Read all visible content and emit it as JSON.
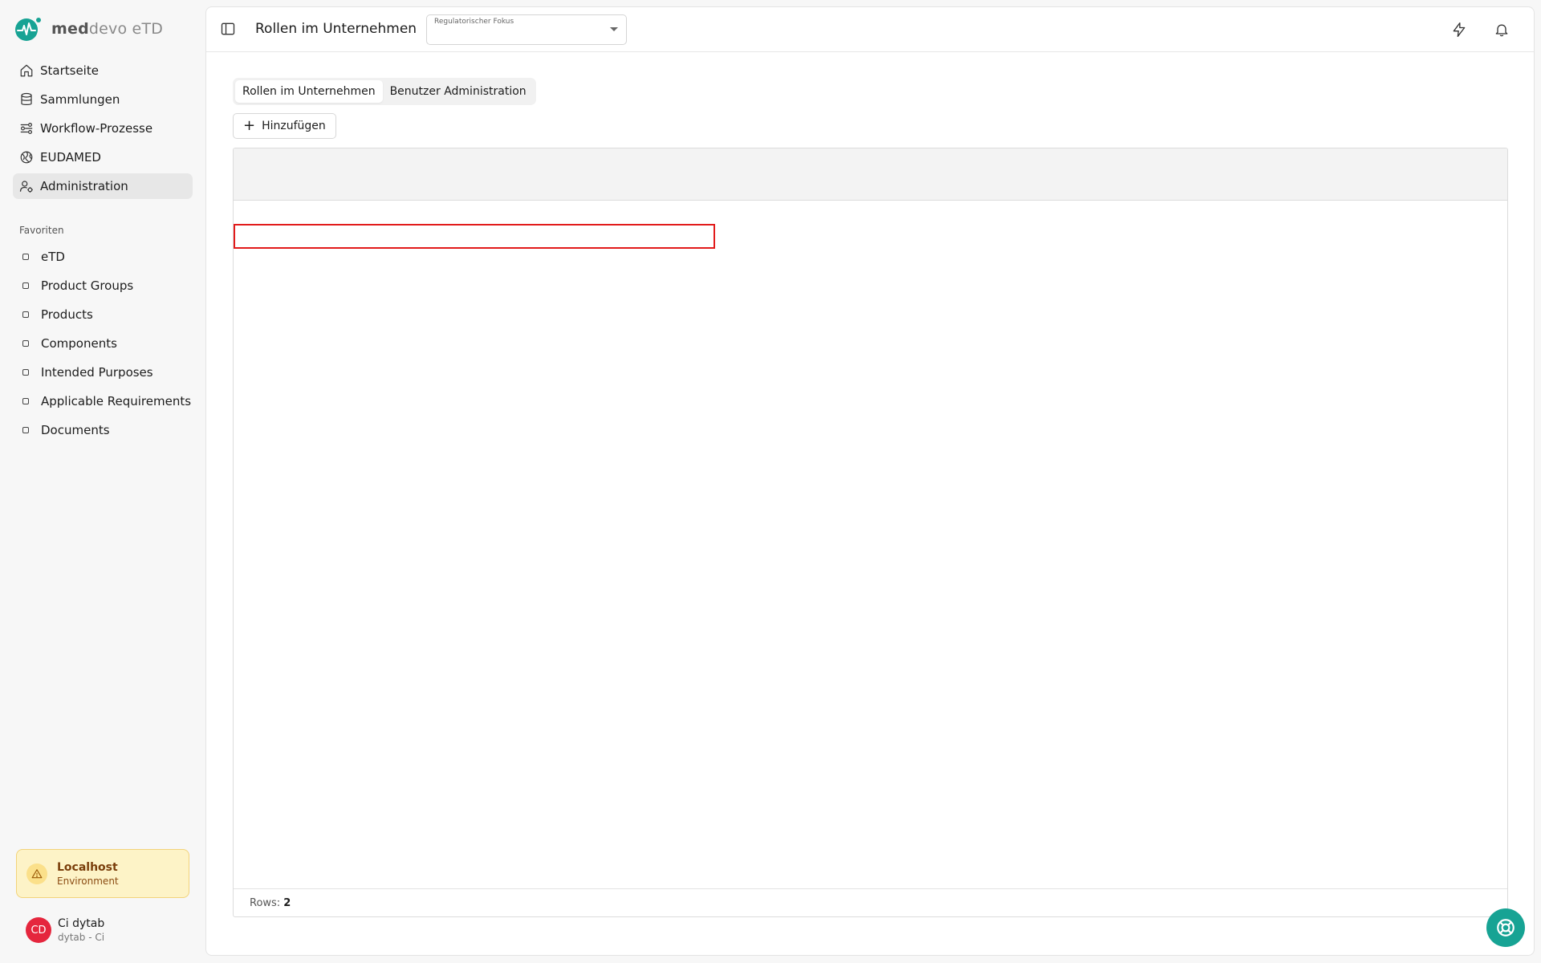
{
  "app": {
    "brand_bold": "med",
    "brand_light": "devo eTD"
  },
  "sidebar": {
    "nav": [
      {
        "label": "Startseite",
        "icon": "home-icon"
      },
      {
        "label": "Sammlungen",
        "icon": "database-icon"
      },
      {
        "label": "Workflow-Prozesse",
        "icon": "workflow-icon"
      },
      {
        "label": "EUDAMED",
        "icon": "globe-icon"
      },
      {
        "label": "Administration",
        "icon": "user-settings-icon",
        "active": true
      }
    ],
    "favorites_title": "Favoriten",
    "favorites": [
      {
        "label": "eTD"
      },
      {
        "label": "Product Groups"
      },
      {
        "label": "Products"
      },
      {
        "label": "Components"
      },
      {
        "label": "Intended Purposes"
      },
      {
        "label": "Applicable Requirements"
      },
      {
        "label": "Documents"
      }
    ],
    "environment": {
      "title": "Localhost",
      "subtitle": "Environment"
    },
    "user": {
      "initials": "CD",
      "name": "Ci dytab",
      "sub": "dytab - Ci"
    }
  },
  "header": {
    "title": "Rollen im Unternehmen",
    "select_label": "Regulatorischer Fokus",
    "select_value": ""
  },
  "tabs": [
    {
      "label": "Rollen im Unternehmen",
      "active": true
    },
    {
      "label": "Benutzer Administration",
      "active": false
    }
  ],
  "toolbar": {
    "add_label": "Hinzufügen"
  },
  "grid": {
    "rows_label": "Rows:",
    "rows_count": "2"
  },
  "colors": {
    "accent": "#17a394",
    "env_bg": "#fdf3c7",
    "avatar": "#e5263d",
    "highlight_border": "#e21b1b"
  }
}
